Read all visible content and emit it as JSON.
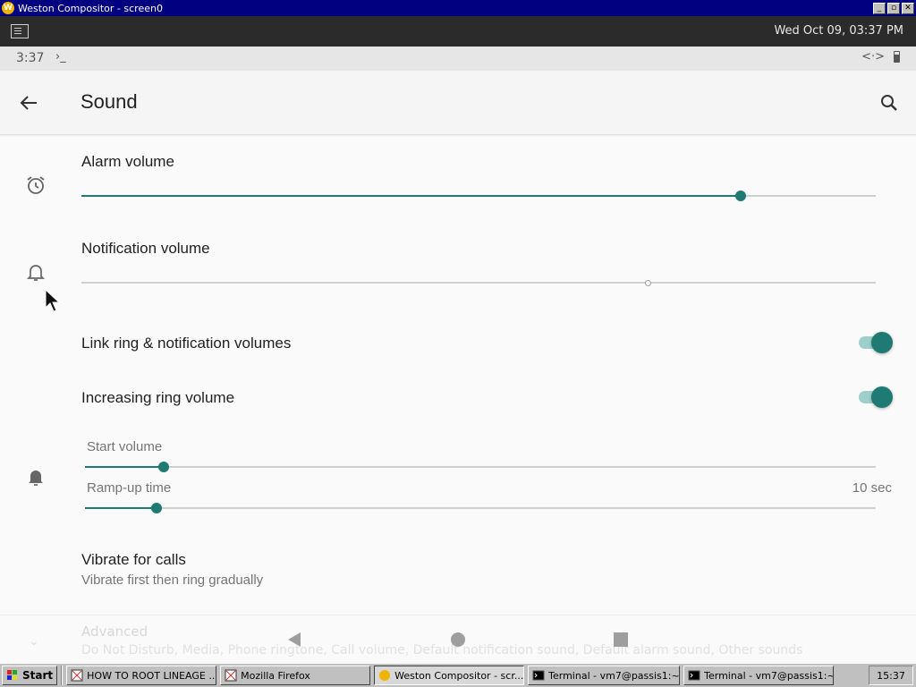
{
  "window": {
    "title": "Weston Compositor - screen0",
    "logo_letter": "W",
    "minimize": "_",
    "maximize": "▫",
    "close": "✕"
  },
  "weston_panel": {
    "clock": "Wed Oct 09, 03:37 PM"
  },
  "status_bar": {
    "time": "3:37",
    "terminal_glyph": "›_",
    "sync_glyph": "<·>"
  },
  "toolbar": {
    "title": "Sound"
  },
  "settings": {
    "alarm": {
      "label": "Alarm volume",
      "level": 0.83
    },
    "notification": {
      "label": "Notification volume",
      "level": 0.713
    },
    "link_ring": {
      "label": "Link ring & notification volumes",
      "enabled": true
    },
    "increasing_ring": {
      "label": "Increasing ring volume",
      "enabled": true
    },
    "start_volume": {
      "label": "Start volume",
      "level": 0.1
    },
    "ramp_up": {
      "label": "Ramp-up time",
      "value": "10 sec",
      "level": 0.09
    },
    "vibrate": {
      "label": "Vibrate for calls",
      "summary": "Vibrate first then ring gradually"
    },
    "advanced": {
      "label": "Advanced",
      "summary": "Do Not Disturb, Media, Phone ringtone, Call volume, Default notification sound, Default alarm sound, Other sounds"
    }
  },
  "taskbar": {
    "start": "Start",
    "items": [
      {
        "label": "HOW TO ROOT LINEAGE ..."
      },
      {
        "label": "Mozilla Firefox"
      },
      {
        "label": "Weston Compositor - scr..."
      },
      {
        "label": "Terminal - vm7@passis1:~"
      },
      {
        "label": "Terminal - vm7@passis1:~"
      }
    ],
    "clock": "15:37"
  },
  "colors": {
    "accent": "#1e7a72",
    "accent_light": "#9fcfcb",
    "title_bar": "#000080"
  }
}
